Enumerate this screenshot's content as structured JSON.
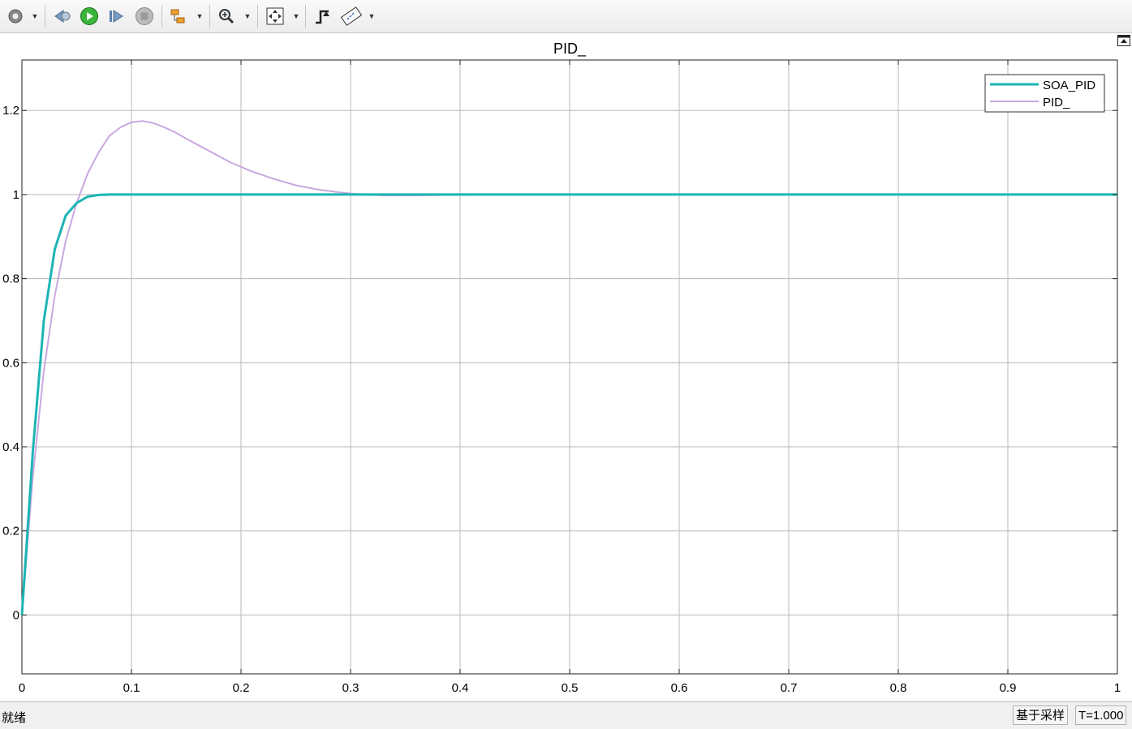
{
  "toolbar": {
    "icons": [
      "settings-icon",
      "step-back-icon",
      "run-icon",
      "step-forward-icon",
      "stop-icon",
      "signal-highlight-icon",
      "zoom-icon",
      "autoscale-icon",
      "triggers-icon",
      "measurements-icon"
    ]
  },
  "colors": {
    "soa_pid": "#1cb5b5",
    "pid": "#c9a8e0",
    "grid": "#b8b8b8",
    "plot_bg": "#ffffff"
  },
  "chart_data": {
    "type": "line",
    "title": "PID_",
    "xlabel": "",
    "ylabel": "",
    "xlim": [
      0,
      1
    ],
    "ylim": [
      -0.14,
      1.32
    ],
    "xticks": [
      "0",
      "0.1",
      "0.2",
      "0.3",
      "0.4",
      "0.5",
      "0.6",
      "0.7",
      "0.8",
      "0.9",
      "1"
    ],
    "yticks": [
      "0",
      "0.2",
      "0.4",
      "0.6",
      "0.8",
      "1",
      "1.2"
    ],
    "grid": true,
    "legend_position": "top-right",
    "series": [
      {
        "name": "SOA_PID",
        "color": "#1cb5b5",
        "x": [
          0,
          0.01,
          0.02,
          0.03,
          0.04,
          0.05,
          0.06,
          0.07,
          0.08,
          0.09,
          0.1,
          0.2,
          0.3,
          0.4,
          0.5,
          0.6,
          0.7,
          0.8,
          0.9,
          1.0
        ],
        "y": [
          0,
          0.39,
          0.7,
          0.87,
          0.95,
          0.98,
          0.995,
          0.999,
          1.0,
          1.0,
          1.0,
          1.0,
          1.0,
          1.0,
          1.0,
          1.0,
          1.0,
          1.0,
          1.0,
          1.0
        ]
      },
      {
        "name": "PID_",
        "color": "#c9a8e0",
        "x": [
          0,
          0.01,
          0.02,
          0.03,
          0.04,
          0.05,
          0.06,
          0.07,
          0.08,
          0.09,
          0.1,
          0.11,
          0.12,
          0.13,
          0.14,
          0.15,
          0.17,
          0.19,
          0.21,
          0.23,
          0.25,
          0.27,
          0.29,
          0.31,
          0.33,
          0.36,
          0.4,
          0.45,
          0.5,
          0.6,
          0.7,
          0.8,
          0.9,
          1.0
        ],
        "y": [
          0,
          0.33,
          0.58,
          0.76,
          0.89,
          0.98,
          1.05,
          1.1,
          1.14,
          1.16,
          1.172,
          1.175,
          1.17,
          1.16,
          1.148,
          1.133,
          1.105,
          1.077,
          1.055,
          1.037,
          1.022,
          1.012,
          1.005,
          1.0,
          0.998,
          0.998,
          0.999,
          1.0,
          1.0,
          1.0,
          1.0,
          1.0,
          1.0,
          1.0
        ]
      }
    ]
  },
  "status": {
    "text": "就绪",
    "mode": "基于采样",
    "time": "T=1.000"
  }
}
